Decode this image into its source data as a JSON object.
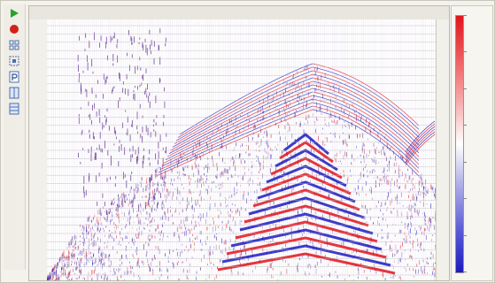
{
  "toolbar": {
    "buttons": [
      {
        "name": "play-icon",
        "color": "#2aa12a"
      },
      {
        "name": "record-icon",
        "color": "#d2211d"
      },
      {
        "name": "grid-icon",
        "color": "#4a6fb3"
      },
      {
        "name": "zoom-icon",
        "color": "#4a6fb3"
      },
      {
        "name": "pick-icon",
        "color": "#4a6fb3"
      },
      {
        "name": "columns-icon",
        "color": "#4a6fb3"
      },
      {
        "name": "rows-icon",
        "color": "#4a6fb3"
      }
    ]
  },
  "column_headers": [
    "",
    "",
    "",
    "",
    "",
    "",
    "",
    "",
    "",
    "",
    "",
    "",
    "",
    "",
    "",
    "",
    "",
    "",
    "",
    "",
    "",
    ""
  ],
  "row_labels": [
    "",
    "",
    "",
    "",
    "",
    "",
    "",
    "",
    "",
    "",
    "",
    "",
    "",
    "",
    "",
    "",
    "",
    "",
    "",
    "",
    "",
    "",
    "",
    "",
    "",
    "",
    "",
    "",
    "",
    "",
    ""
  ],
  "colorbar_labels": [
    "",
    "",
    "",
    "",
    "",
    "",
    "",
    ""
  ],
  "colors": {
    "positive": "#e0141c",
    "negative": "#1b1bbf",
    "wiggle": "#5b2a8c",
    "background": "#ffffff"
  }
}
